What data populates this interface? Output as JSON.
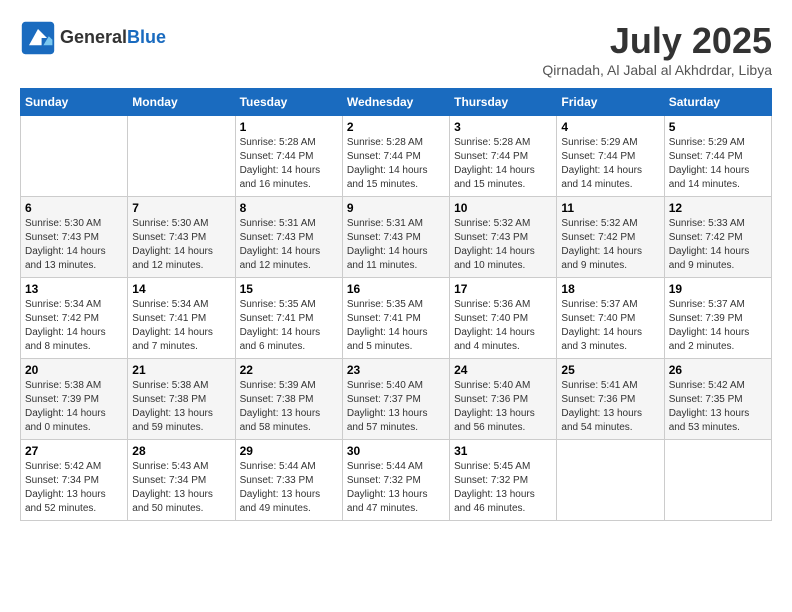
{
  "header": {
    "logo_line1": "General",
    "logo_line2": "Blue",
    "month": "July 2025",
    "location": "Qirnadah, Al Jabal al Akhdrdar, Libya"
  },
  "days_of_week": [
    "Sunday",
    "Monday",
    "Tuesday",
    "Wednesday",
    "Thursday",
    "Friday",
    "Saturday"
  ],
  "weeks": [
    [
      {
        "day": "",
        "detail": ""
      },
      {
        "day": "",
        "detail": ""
      },
      {
        "day": "1",
        "detail": "Sunrise: 5:28 AM\nSunset: 7:44 PM\nDaylight: 14 hours and 16 minutes."
      },
      {
        "day": "2",
        "detail": "Sunrise: 5:28 AM\nSunset: 7:44 PM\nDaylight: 14 hours and 15 minutes."
      },
      {
        "day": "3",
        "detail": "Sunrise: 5:28 AM\nSunset: 7:44 PM\nDaylight: 14 hours and 15 minutes."
      },
      {
        "day": "4",
        "detail": "Sunrise: 5:29 AM\nSunset: 7:44 PM\nDaylight: 14 hours and 14 minutes."
      },
      {
        "day": "5",
        "detail": "Sunrise: 5:29 AM\nSunset: 7:44 PM\nDaylight: 14 hours and 14 minutes."
      }
    ],
    [
      {
        "day": "6",
        "detail": "Sunrise: 5:30 AM\nSunset: 7:43 PM\nDaylight: 14 hours and 13 minutes."
      },
      {
        "day": "7",
        "detail": "Sunrise: 5:30 AM\nSunset: 7:43 PM\nDaylight: 14 hours and 12 minutes."
      },
      {
        "day": "8",
        "detail": "Sunrise: 5:31 AM\nSunset: 7:43 PM\nDaylight: 14 hours and 12 minutes."
      },
      {
        "day": "9",
        "detail": "Sunrise: 5:31 AM\nSunset: 7:43 PM\nDaylight: 14 hours and 11 minutes."
      },
      {
        "day": "10",
        "detail": "Sunrise: 5:32 AM\nSunset: 7:43 PM\nDaylight: 14 hours and 10 minutes."
      },
      {
        "day": "11",
        "detail": "Sunrise: 5:32 AM\nSunset: 7:42 PM\nDaylight: 14 hours and 9 minutes."
      },
      {
        "day": "12",
        "detail": "Sunrise: 5:33 AM\nSunset: 7:42 PM\nDaylight: 14 hours and 9 minutes."
      }
    ],
    [
      {
        "day": "13",
        "detail": "Sunrise: 5:34 AM\nSunset: 7:42 PM\nDaylight: 14 hours and 8 minutes."
      },
      {
        "day": "14",
        "detail": "Sunrise: 5:34 AM\nSunset: 7:41 PM\nDaylight: 14 hours and 7 minutes."
      },
      {
        "day": "15",
        "detail": "Sunrise: 5:35 AM\nSunset: 7:41 PM\nDaylight: 14 hours and 6 minutes."
      },
      {
        "day": "16",
        "detail": "Sunrise: 5:35 AM\nSunset: 7:41 PM\nDaylight: 14 hours and 5 minutes."
      },
      {
        "day": "17",
        "detail": "Sunrise: 5:36 AM\nSunset: 7:40 PM\nDaylight: 14 hours and 4 minutes."
      },
      {
        "day": "18",
        "detail": "Sunrise: 5:37 AM\nSunset: 7:40 PM\nDaylight: 14 hours and 3 minutes."
      },
      {
        "day": "19",
        "detail": "Sunrise: 5:37 AM\nSunset: 7:39 PM\nDaylight: 14 hours and 2 minutes."
      }
    ],
    [
      {
        "day": "20",
        "detail": "Sunrise: 5:38 AM\nSunset: 7:39 PM\nDaylight: 14 hours and 0 minutes."
      },
      {
        "day": "21",
        "detail": "Sunrise: 5:38 AM\nSunset: 7:38 PM\nDaylight: 13 hours and 59 minutes."
      },
      {
        "day": "22",
        "detail": "Sunrise: 5:39 AM\nSunset: 7:38 PM\nDaylight: 13 hours and 58 minutes."
      },
      {
        "day": "23",
        "detail": "Sunrise: 5:40 AM\nSunset: 7:37 PM\nDaylight: 13 hours and 57 minutes."
      },
      {
        "day": "24",
        "detail": "Sunrise: 5:40 AM\nSunset: 7:36 PM\nDaylight: 13 hours and 56 minutes."
      },
      {
        "day": "25",
        "detail": "Sunrise: 5:41 AM\nSunset: 7:36 PM\nDaylight: 13 hours and 54 minutes."
      },
      {
        "day": "26",
        "detail": "Sunrise: 5:42 AM\nSunset: 7:35 PM\nDaylight: 13 hours and 53 minutes."
      }
    ],
    [
      {
        "day": "27",
        "detail": "Sunrise: 5:42 AM\nSunset: 7:34 PM\nDaylight: 13 hours and 52 minutes."
      },
      {
        "day": "28",
        "detail": "Sunrise: 5:43 AM\nSunset: 7:34 PM\nDaylight: 13 hours and 50 minutes."
      },
      {
        "day": "29",
        "detail": "Sunrise: 5:44 AM\nSunset: 7:33 PM\nDaylight: 13 hours and 49 minutes."
      },
      {
        "day": "30",
        "detail": "Sunrise: 5:44 AM\nSunset: 7:32 PM\nDaylight: 13 hours and 47 minutes."
      },
      {
        "day": "31",
        "detail": "Sunrise: 5:45 AM\nSunset: 7:32 PM\nDaylight: 13 hours and 46 minutes."
      },
      {
        "day": "",
        "detail": ""
      },
      {
        "day": "",
        "detail": ""
      }
    ]
  ]
}
